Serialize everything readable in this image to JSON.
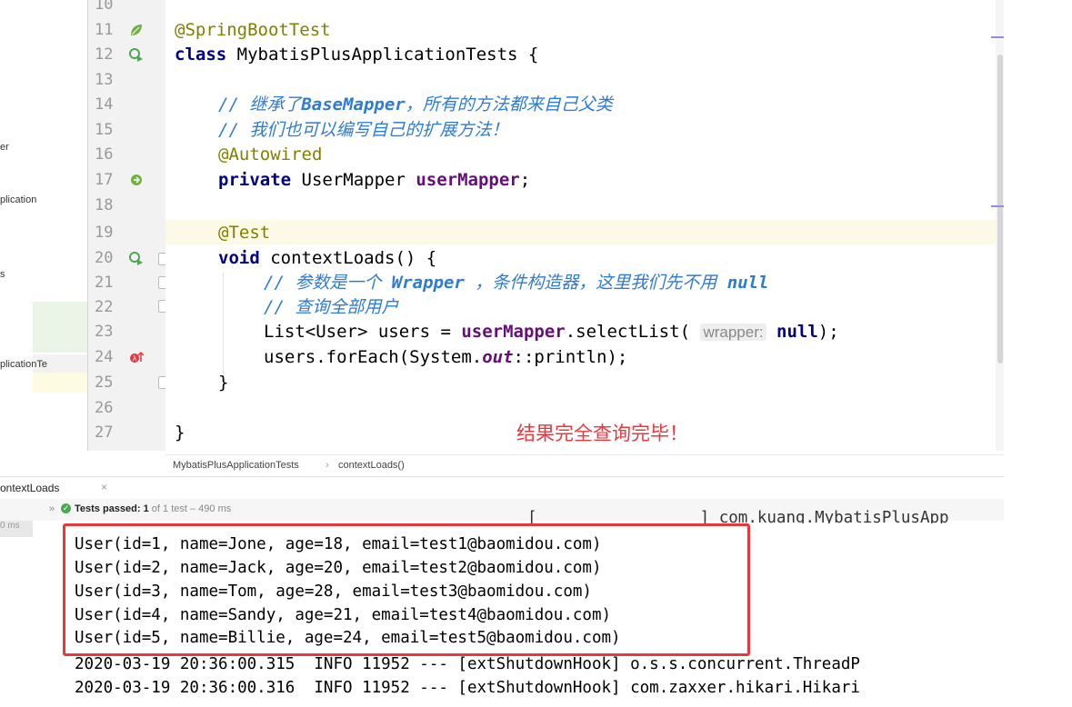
{
  "project_panel": {
    "items": [
      {
        "label": "er"
      },
      {
        "label": "plication"
      },
      {
        "label": "s"
      },
      {
        "label": "plicationTe"
      }
    ]
  },
  "gutter": {
    "lines": [
      "10",
      "11",
      "12",
      "13",
      "14",
      "15",
      "16",
      "17",
      "18",
      "19",
      "20",
      "21",
      "22",
      "23",
      "24",
      "25",
      "26",
      "27"
    ]
  },
  "code": {
    "l11_ann": "@SpringBootTest",
    "l12_kw": "class",
    "l12_name": " MybatisPlusApplicationTests {",
    "l14_cm": "// 继承了",
    "l14_cmb": "BaseMapper",
    "l14_cm2": "，所有的方法都来自己父类",
    "l15_cm": "// 我们也可以编写自己的扩展方法！",
    "l16_ann": "@Autowired",
    "l17_kw": "private",
    "l17_type": " UserMapper ",
    "l17_field": "userMapper",
    "l17_end": ";",
    "l19_ann": "@Test",
    "l20_kw": "void",
    "l20_rest": " contextLoads() {",
    "l21_cm": "// 参数是一个 ",
    "l21_cmb": "Wrapper",
    "l21_cm2": " ，条件构造器，这里我们先不用 ",
    "l21_cmb2": "null",
    "l22_cm": "// 查询全部用户",
    "l23_a": "List<User> users = ",
    "l23_field": "userMapper",
    "l23_b": ".selectList( ",
    "l23_hint": "wrapper:",
    "l23_kw": " null",
    "l23_end": ");",
    "l24_a": "users.forEach(System.",
    "l24_out": "out",
    "l24_b": "::println);",
    "l25": "}",
    "l27": "}"
  },
  "annotation_text": "结果完全查询完毕！",
  "breadcrumb": {
    "class_name": "MybatisPlusApplicationTests",
    "separator": "›",
    "method_name": "contextLoads()"
  },
  "run_panel": {
    "tab_label": "ontextLoads",
    "close_glyph": "×",
    "arrows": "»",
    "status_bold": "Tests passed: ",
    "status_count": "1",
    "status_rest": " of 1 test – 490 ms",
    "left_time": "0 ms"
  },
  "console": {
    "partial_top": "[                 ] com.kuang.MybatisPlusApp",
    "lines": [
      "User(id=1, name=Jone, age=18, email=test1@baomidou.com)",
      "User(id=2, name=Jack, age=20, email=test2@baomidou.com)",
      "User(id=3, name=Tom, age=28, email=test3@baomidou.com)",
      "User(id=4, name=Sandy, age=21, email=test4@baomidou.com)",
      "User(id=5, name=Billie, age=24, email=test5@baomidou.com)",
      "2020-03-19 20:36:00.315  INFO 11952 --- [extShutdownHook] o.s.s.concurrent.ThreadP",
      "2020-03-19 20:36:00.316  INFO 11952 --- [extShutdownHook] com.zaxxer.hikari.Hikari"
    ]
  },
  "colors": {
    "keyword": "#000080",
    "annotation": "#808000",
    "comment": "#2e7bd6",
    "field": "#660e7a",
    "highlight_box": "#e8383d",
    "current_line": "#fcfae6"
  }
}
